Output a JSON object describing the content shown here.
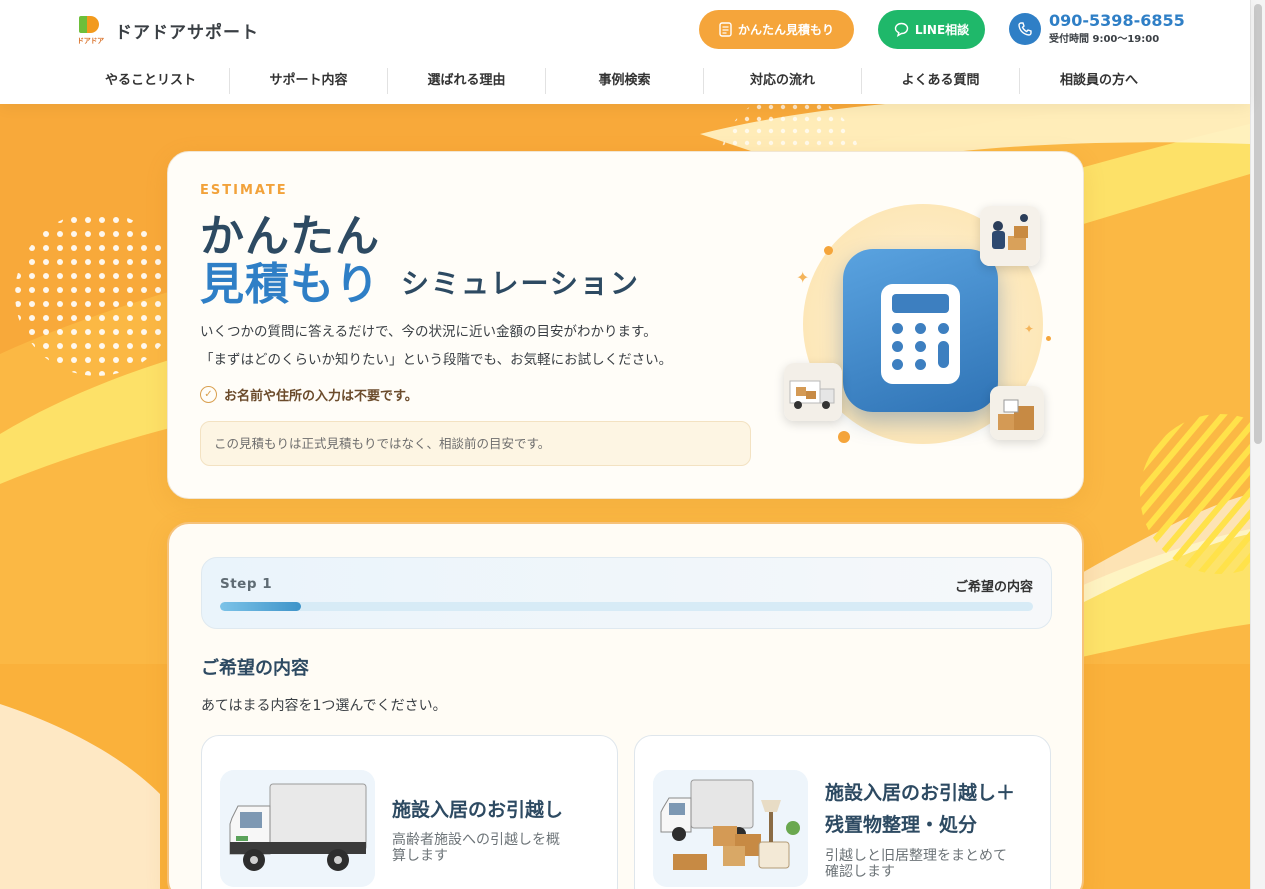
{
  "header": {
    "logo_text": "ドアドアサポート",
    "logo_sub": "ドアドア",
    "estimate_button": "かんたん見積もり",
    "line_button": "LINE相談",
    "phone_number": "090-5398-6855",
    "phone_hours": "受付時間 9:00〜19:00"
  },
  "nav": {
    "items": [
      {
        "label": "やることリスト"
      },
      {
        "label": "サポート内容"
      },
      {
        "label": "選ばれる理由"
      },
      {
        "label": "事例検索"
      },
      {
        "label": "対応の流れ"
      },
      {
        "label": "よくある質問"
      },
      {
        "label": "相談員の方へ"
      }
    ]
  },
  "hero": {
    "eyebrow": "ESTIMATE",
    "title_line1": "かんたん",
    "title_line2": "見積もり",
    "title_suffix": "シミュレーション",
    "lead_line1": "いくつかの質問に答えるだけで、今の状況に近い金額の目安がわかります。",
    "lead_line2": "「まずはどのくらいか知りたい」という段階でも、お気軽にお試しください。",
    "check_text": "お名前や住所の入力は不要です。",
    "notice": "この見積もりは正式見積もりではなく、相談前の目安です。"
  },
  "step": {
    "label": "Step 1",
    "name": "ご希望の内容",
    "progress": 0.1
  },
  "question": {
    "title": "ご希望の内容",
    "subtitle": "あてはまる内容を1つ選んでください。"
  },
  "options": [
    {
      "title_line1": "施設入居のお引越し",
      "title_line2": "",
      "desc_line1": "高齢者施設への引越しを概",
      "desc_line2": "算します"
    },
    {
      "title_line1": "施設入居のお引越し＋",
      "title_line2": "残置物整理・処分",
      "desc_line1": "引越しと旧居整理をまとめて",
      "desc_line2": "確認します"
    }
  ],
  "colors": {
    "accent_orange": "#f5a53b",
    "line_green": "#1fb86a",
    "brand_blue": "#2f7fc6",
    "navy": "#2d4a62"
  },
  "icons": [
    "document-icon",
    "chat-bubble-icon",
    "phone-icon",
    "check-icon",
    "calculator-icon"
  ]
}
